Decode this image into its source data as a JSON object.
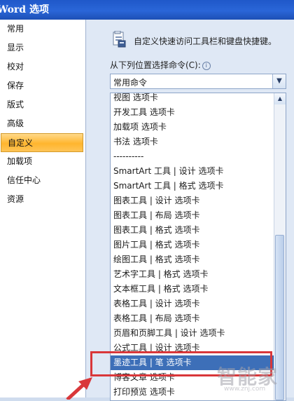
{
  "window": {
    "title": "Word 选项"
  },
  "sidebar": {
    "items": [
      {
        "label": "常用",
        "active": false
      },
      {
        "label": "显示",
        "active": false
      },
      {
        "label": "校对",
        "active": false
      },
      {
        "label": "保存",
        "active": false
      },
      {
        "label": "版式",
        "active": false
      },
      {
        "label": "高级",
        "active": false
      },
      {
        "label": "自定义",
        "active": true
      },
      {
        "label": "加载项",
        "active": false
      },
      {
        "label": "信任中心",
        "active": false
      },
      {
        "label": "资源",
        "active": false
      }
    ]
  },
  "main": {
    "header": "自定义快速访问工具栏和键盘快捷键。",
    "choose_label": "从下列位置选择命令(C):",
    "info_icon": "i",
    "select_value": "常用命令",
    "list_items": [
      "视图 选项卡",
      "开发工具 选项卡",
      "加载项 选项卡",
      "书法 选项卡",
      "----------",
      "SmartArt 工具 | 设计 选项卡",
      "SmartArt 工具 | 格式 选项卡",
      "图表工具 | 设计 选项卡",
      "图表工具 | 布局 选项卡",
      "图表工具 | 格式 选项卡",
      "图片工具 | 格式 选项卡",
      "绘图工具 | 格式 选项卡",
      "艺术字工具 | 格式 选项卡",
      "文本框工具 | 格式 选项卡",
      "表格工具 | 设计 选项卡",
      "表格工具 | 布局 选项卡",
      "页眉和页脚工具 | 设计 选项卡",
      "公式工具 | 设计 选项卡",
      "墨迹工具 | 笔 选项卡",
      "博客文章 选项卡",
      "打印预览 选项卡"
    ],
    "selected_index": 18
  },
  "watermark": {
    "big": "智能家",
    "small": "www.znj.com"
  },
  "colors": {
    "title_bar": "#2a66d8",
    "active_nav": "#ffb52e",
    "selection": "#3d6fb8",
    "highlight": "#d9373a"
  }
}
